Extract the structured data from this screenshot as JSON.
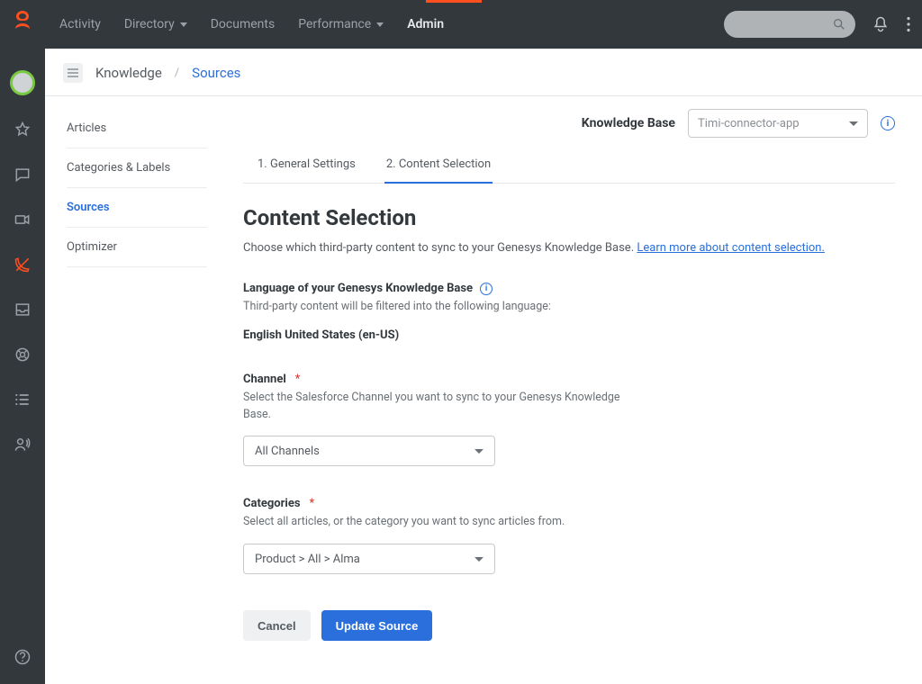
{
  "topnav": {
    "items": [
      {
        "label": "Activity",
        "has_dropdown": false
      },
      {
        "label": "Directory",
        "has_dropdown": true
      },
      {
        "label": "Documents",
        "has_dropdown": false
      },
      {
        "label": "Performance",
        "has_dropdown": true
      },
      {
        "label": "Admin",
        "has_dropdown": false,
        "active": true
      }
    ]
  },
  "breadcrumb": {
    "root": "Knowledge",
    "current": "Sources"
  },
  "subnav": {
    "items": [
      {
        "label": "Articles"
      },
      {
        "label": "Categories & Labels"
      },
      {
        "label": "Sources",
        "active": true
      },
      {
        "label": "Optimizer"
      }
    ]
  },
  "kb": {
    "label": "Knowledge Base",
    "selected": "Timi-connector-app"
  },
  "tabs": [
    {
      "label": "1. General Settings"
    },
    {
      "label": "2. Content Selection",
      "active": true
    }
  ],
  "section": {
    "title": "Content Selection",
    "desc_prefix": "Choose which third-party content to sync to your Genesys Knowledge Base. ",
    "desc_link": "Learn more about content selection."
  },
  "language": {
    "label": "Language of your Genesys Knowledge Base",
    "help": "Third-party content will be filtered into the following language:",
    "value": "English United States (en-US)"
  },
  "channel": {
    "label": "Channel",
    "help": "Select the Salesforce Channel you want to sync to your Genesys Knowledge Base.",
    "value": "All Channels"
  },
  "categories": {
    "label": "Categories",
    "help": "Select all articles, or the category you want to sync articles from.",
    "value": "Product > All > Alma"
  },
  "actions": {
    "cancel": "Cancel",
    "update": "Update Source"
  }
}
